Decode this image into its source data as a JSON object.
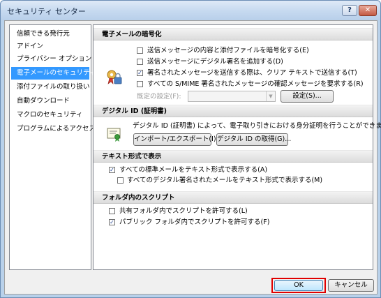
{
  "window": {
    "title": "セキュリティ センター",
    "help_glyph": "?",
    "close_glyph": "✕"
  },
  "sidebar": {
    "items": [
      {
        "label": "信頼できる発行元"
      },
      {
        "label": "アドイン"
      },
      {
        "label": "プライバシー オプション"
      },
      {
        "label": "電子メールのセキュリティ",
        "selected": true
      },
      {
        "label": "添付ファイルの取り扱い"
      },
      {
        "label": "自動ダウンロード"
      },
      {
        "label": "マクロのセキュリティ"
      },
      {
        "label": "プログラムによるアクセス"
      }
    ]
  },
  "encryption": {
    "heading": "電子メールの暗号化",
    "options": [
      {
        "label": "送信メッセージの内容と添付ファイルを暗号化する(E)",
        "checked": false
      },
      {
        "label": "送信メッセージにデジタル署名を追加する(D)",
        "checked": false
      },
      {
        "label": "署名されたメッセージを送信する際は、クリア テキストで送信する(T)",
        "checked": true
      },
      {
        "label": "すべての S/MIME 署名されたメッセージの確認メッセージを要求する(R)",
        "checked": false
      }
    ],
    "default_setting_label": "既定の設定(F):",
    "default_setting_value": "",
    "settings_button": "設定(S)..."
  },
  "digital_id": {
    "heading": "デジタル ID (証明書)",
    "description": "デジタル ID (証明書) によって、電子取り引きにおける身分証明を行うことができます。",
    "import_button": "インポート/エクスポート(I)...",
    "get_button": "デジタル ID の取得(G)..."
  },
  "text_format": {
    "heading": "テキスト形式で表示",
    "options": [
      {
        "label": "すべての標準メールをテキスト形式で表示する(A)",
        "checked": true
      },
      {
        "label": "すべてのデジタル署名されたメールをテキスト形式で表示する(M)",
        "checked": false
      }
    ]
  },
  "folder_script": {
    "heading": "フォルダ内のスクリプト",
    "options": [
      {
        "label": "共有フォルダ内でスクリプトを許可する(L)",
        "checked": false
      },
      {
        "label": "パブリック フォルダ内でスクリプトを許可する(F)",
        "checked": true
      }
    ]
  },
  "footer": {
    "ok_button": "OK",
    "cancel_button": "キャンセル"
  },
  "glyphs": {
    "check": "✓",
    "dropdown_arrow": "▼"
  },
  "colors": {
    "selection": "#3399ff",
    "highlight_frame": "#e00000"
  }
}
